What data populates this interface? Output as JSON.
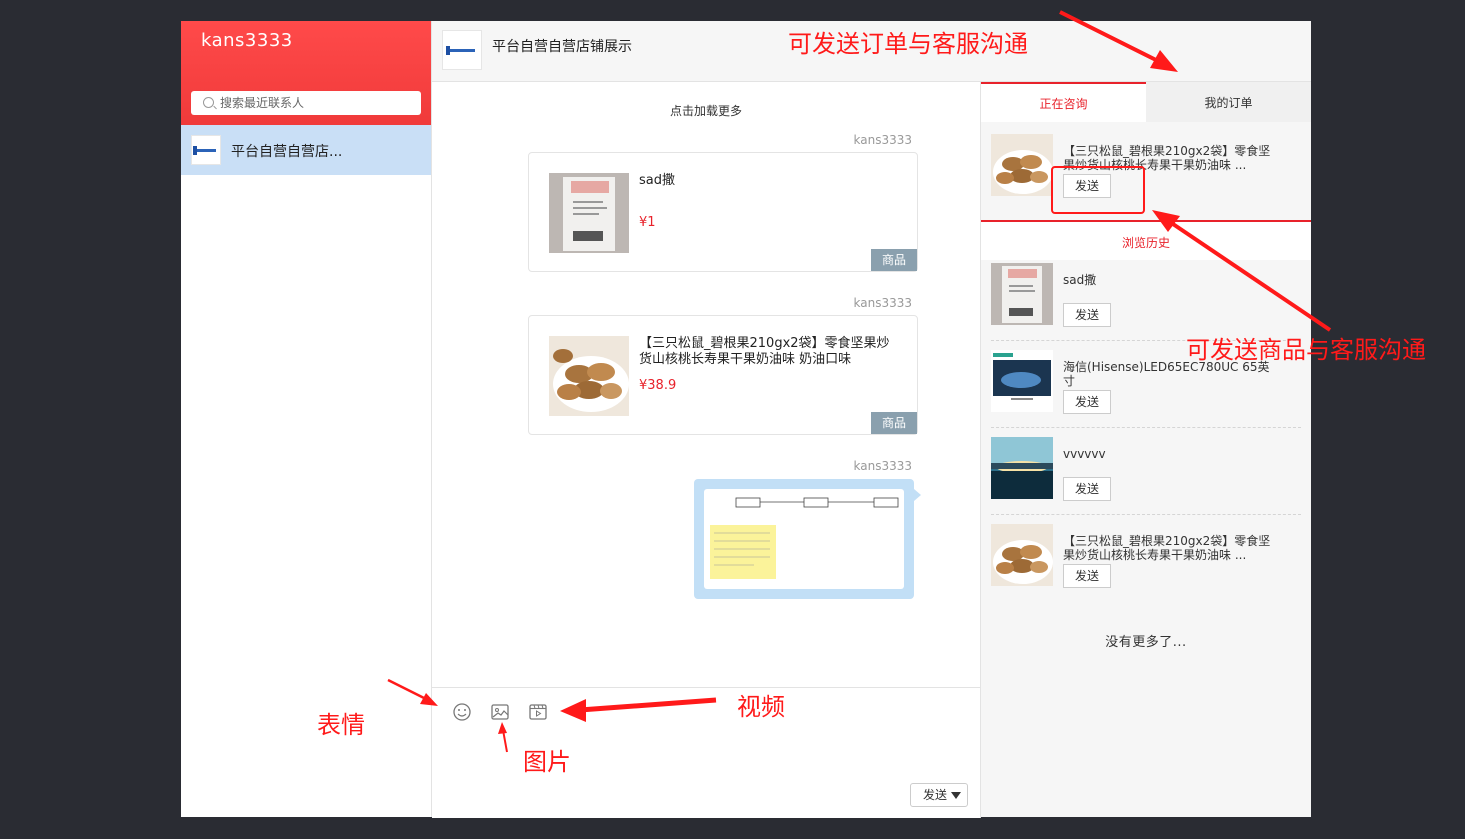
{
  "user": {
    "name": "kans3333"
  },
  "search": {
    "placeholder": "搜索最近联系人"
  },
  "contacts": [
    {
      "name": "平台自营自营店..."
    }
  ],
  "chat": {
    "title": "平台自营自营店铺展示",
    "load_more": "点击加载更多",
    "messages": [
      {
        "sender": "kans3333",
        "type": "product",
        "name": "sad撒",
        "price": "¥1",
        "tag": "商品"
      },
      {
        "sender": "kans3333",
        "type": "product",
        "name": "【三只松鼠_碧根果210gx2袋】零食坚果炒货山核桃长寿果干果奶油味 奶油口味",
        "price": "¥38.9",
        "tag": "商品"
      },
      {
        "sender": "kans3333",
        "type": "image"
      }
    ]
  },
  "toolbar": {
    "icons": [
      "emoji-icon",
      "image-icon",
      "video-icon"
    ],
    "send_label": "发送"
  },
  "right_panel": {
    "tabs": [
      {
        "label": "正在咨询",
        "active": true
      },
      {
        "label": "我的订单",
        "active": false
      }
    ],
    "consulting": {
      "name": "【三只松鼠_碧根果210gx2袋】零食坚果炒货山核桃长寿果干果奶油味 ...",
      "send_label": "发送"
    },
    "history_title": "浏览历史",
    "history": [
      {
        "name": "sad撒",
        "send_label": "发送"
      },
      {
        "name": "海信(Hisense)LED65EC780UC 65英寸",
        "send_label": "发送"
      },
      {
        "name": "vvvvvv",
        "send_label": "发送"
      },
      {
        "name": "【三只松鼠_碧根果210gx2袋】零食坚果炒货山核桃长寿果干果奶油味 ...",
        "send_label": "发送"
      }
    ],
    "no_more": "没有更多了..."
  },
  "annotations": {
    "order": "可发送订单与客服沟通",
    "product": "可发送商品与客服沟通",
    "emoji": "表情",
    "image": "图片",
    "video": "视频",
    "color": "#ff1a1a"
  }
}
